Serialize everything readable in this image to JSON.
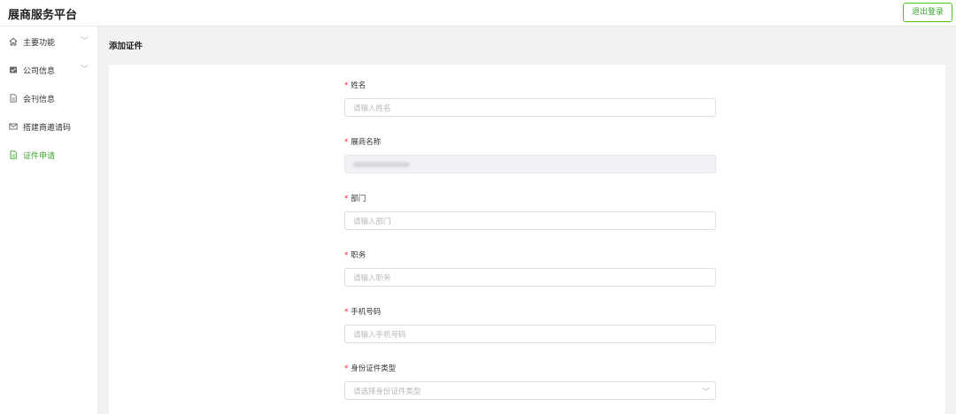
{
  "app": {
    "title": "展商服务平台"
  },
  "header": {
    "logout_label": "退出登录"
  },
  "sidebar": {
    "items": [
      {
        "label": "主要功能",
        "icon": "home-icon",
        "expandable": true,
        "active": false
      },
      {
        "label": "公司信息",
        "icon": "company-card-icon",
        "expandable": true,
        "active": false
      },
      {
        "label": "会刊信息",
        "icon": "document-icon",
        "expandable": false,
        "active": false
      },
      {
        "label": "搭建商邀请码",
        "icon": "mail-icon",
        "expandable": false,
        "active": false
      },
      {
        "label": "证件申请",
        "icon": "document-icon",
        "expandable": false,
        "active": true
      }
    ]
  },
  "page": {
    "title": "添加证件"
  },
  "form": {
    "fields": [
      {
        "label": "姓名",
        "required": true,
        "placeholder": "请输入姓名",
        "value": ""
      },
      {
        "label": "展商名称",
        "required": true,
        "placeholder": "",
        "value": "",
        "disabled": true,
        "value_obscured": true
      },
      {
        "label": "部门",
        "required": true,
        "placeholder": "请输入部门",
        "value": ""
      },
      {
        "label": "职务",
        "required": true,
        "placeholder": "请输入职务",
        "value": ""
      },
      {
        "label": "手机号码",
        "required": true,
        "placeholder": "请输入手机号码",
        "value": ""
      },
      {
        "label": "身份证件类型",
        "required": true,
        "placeholder": "请选择身份证件类型",
        "value": "",
        "type": "select"
      }
    ]
  },
  "colors": {
    "accent": "#3aa52b",
    "required": "#f5222d",
    "background": "#f2f2f2"
  }
}
